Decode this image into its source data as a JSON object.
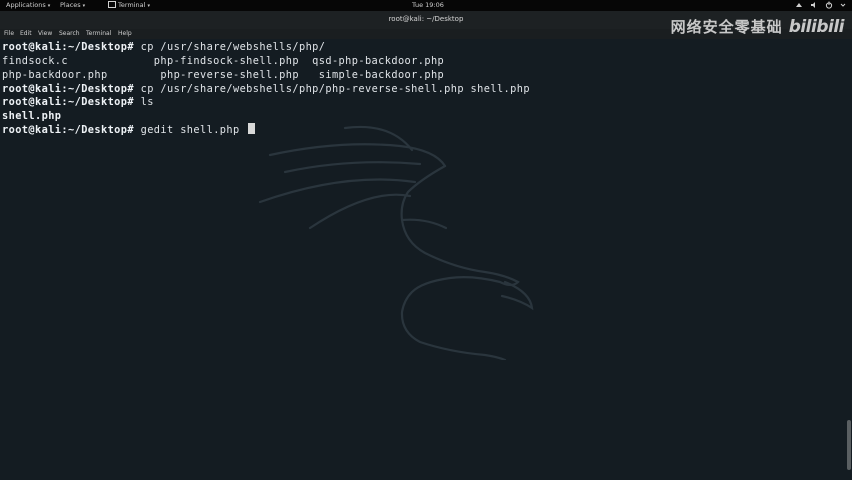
{
  "topbar": {
    "applications": "Applications",
    "places": "Places",
    "terminal": "Terminal",
    "clock": "Tue 19:06",
    "caret": "▾"
  },
  "window": {
    "title": "root@kali: ~/Desktop"
  },
  "menu": [
    "File",
    "Edit",
    "View",
    "Search",
    "Terminal",
    "Help"
  ],
  "watermark": {
    "text": "网络安全零基础",
    "logo": "bilibili"
  },
  "terminal": {
    "lines": [
      {
        "prompt": "root@kali:~/Desktop#",
        "text": " cp /usr/share/webshells/php/"
      },
      {
        "prompt": "",
        "text": "findsock.c             php-findsock-shell.php  qsd-php-backdoor.php"
      },
      {
        "prompt": "",
        "text": "php-backdoor.php        php-reverse-shell.php   simple-backdoor.php"
      },
      {
        "prompt": "root@kali:~/Desktop#",
        "text": " cp /usr/share/webshells/php/php-reverse-shell.php shell.php"
      },
      {
        "prompt": "root@kali:~/Desktop#",
        "text": " ls"
      },
      {
        "prompt": "",
        "text": "shell.php",
        "bold": true
      },
      {
        "prompt": "root@kali:~/Desktop#",
        "text": " gedit shell.php "
      }
    ]
  }
}
